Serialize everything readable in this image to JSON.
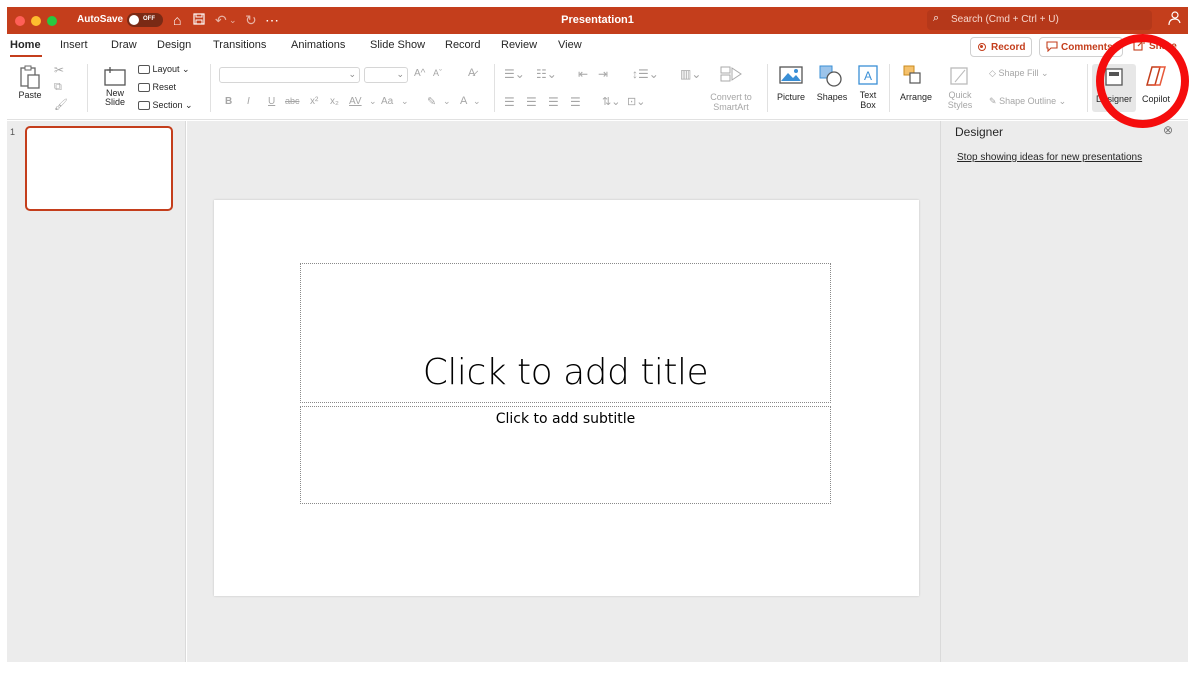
{
  "titlebar": {
    "autosave_label": "AutoSave",
    "autosave_state": "OFF",
    "title": "Presentation1",
    "search_placeholder": "Search (Cmd + Ctrl + U)",
    "bg_color": "#c43e1c"
  },
  "tabs": [
    "Home",
    "Insert",
    "Draw",
    "Design",
    "Transitions",
    "Animations",
    "Slide Show",
    "Record",
    "Review",
    "View"
  ],
  "actions": {
    "record": "Record",
    "comments": "Comments",
    "share": "Share"
  },
  "ribbon": {
    "paste": "Paste",
    "new_slide": "New",
    "new_slide_2": "Slide",
    "layout": "Layout",
    "reset": "Reset",
    "section": "Section",
    "bold": "B",
    "italic": "I",
    "underline": "U",
    "strike": "abc",
    "superscript": "x²",
    "subscript": "x₂",
    "char_spacing": "AV",
    "change_case": "Aa",
    "font_grow": "A^",
    "font_shrink": "Aˇ",
    "convert_smartart_1": "Convert to",
    "convert_smartart_2": "SmartArt",
    "picture": "Picture",
    "shapes": "Shapes",
    "text_box_1": "Text",
    "text_box_2": "Box",
    "arrange": "Arrange",
    "quick_styles_1": "Quick",
    "quick_styles_2": "Styles",
    "shape_fill": "Shape Fill",
    "shape_outline": "Shape Outline",
    "designer": "Designer",
    "copilot": "Copilot"
  },
  "thumbnails": {
    "slide_number": "1"
  },
  "slide": {
    "title_placeholder": "Click to add title",
    "subtitle_placeholder": "Click to add subtitle"
  },
  "designer_pane": {
    "title": "Designer",
    "link": "Stop showing ideas for new presentations"
  },
  "annotation": {
    "color": "#f50d0d"
  }
}
